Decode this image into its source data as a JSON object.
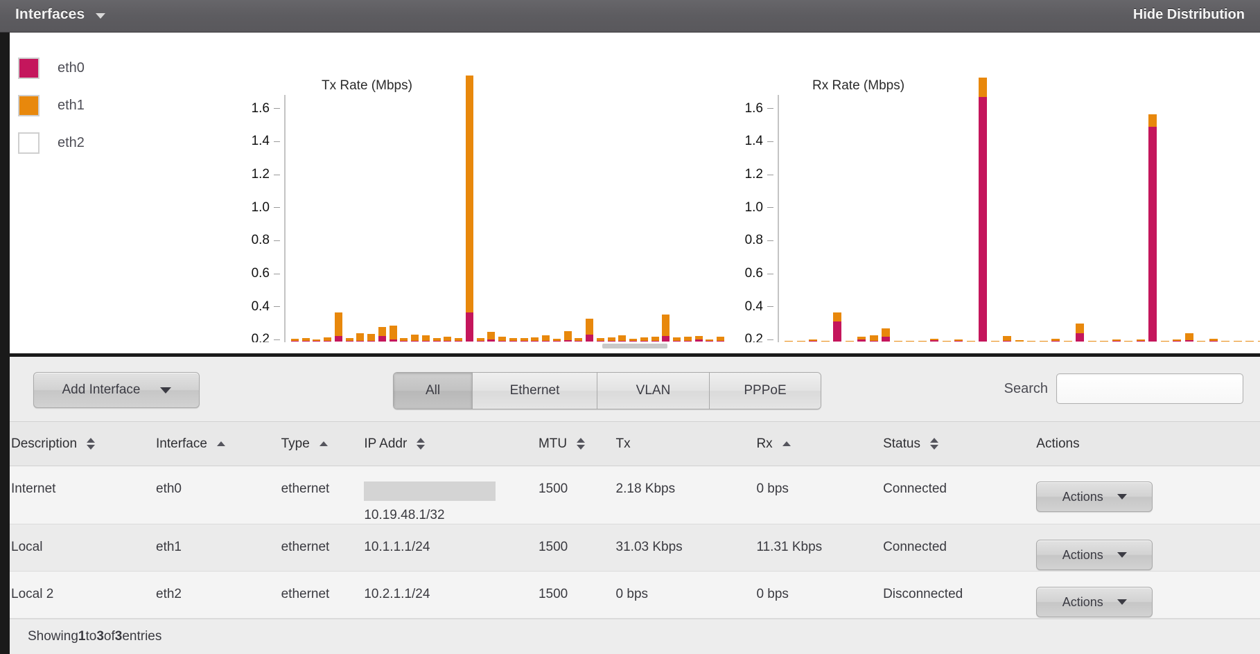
{
  "header": {
    "title": "Interfaces",
    "dropdown_icon": "chevron-down-icon",
    "hide_distribution": "Hide Distribution"
  },
  "legend": {
    "items": [
      {
        "label": "eth0",
        "color": "#c4165c",
        "enabled": true
      },
      {
        "label": "eth1",
        "color": "#e8880c",
        "enabled": true
      },
      {
        "label": "eth2",
        "color": "#ffffff",
        "enabled": false
      }
    ]
  },
  "chart_data": [
    {
      "type": "bar",
      "title": "Tx Rate (Mbps)",
      "xlabel": "",
      "ylabel": "",
      "ylim": [
        0,
        1.7
      ],
      "yticks": [
        "0.2",
        "0.4",
        "0.6",
        "0.8",
        "1.0",
        "1.2",
        "1.4",
        "1.6"
      ],
      "ytick_values": [
        0.2,
        0.4,
        0.6,
        0.8,
        1.0,
        1.2,
        1.4,
        1.6
      ],
      "grid": false,
      "legend_position": "left-outside",
      "stacked": true,
      "series": [
        {
          "name": "eth0",
          "color": "#c4165c",
          "values": [
            0.004,
            0.004,
            0.003,
            0.004,
            0.035,
            0.005,
            0.006,
            0.006,
            0.035,
            0.012,
            0.006,
            0.005,
            0.006,
            0.004,
            0.006,
            0.005,
            0.175,
            0.005,
            0.014,
            0.005,
            0.005,
            0.005,
            0.005,
            0.006,
            0.005,
            0.007,
            0.004,
            0.04,
            0.005,
            0.005,
            0.006,
            0.005,
            0.005,
            0.006,
            0.032,
            0.005,
            0.005,
            0.012,
            0.004,
            0.006
          ]
        },
        {
          "name": "eth1",
          "color": "#e8880c",
          "values": [
            0.014,
            0.015,
            0.01,
            0.022,
            0.14,
            0.014,
            0.046,
            0.042,
            0.053,
            0.085,
            0.017,
            0.036,
            0.03,
            0.016,
            0.024,
            0.018,
            1.435,
            0.014,
            0.043,
            0.026,
            0.018,
            0.018,
            0.02,
            0.03,
            0.012,
            0.054,
            0.017,
            0.1,
            0.016,
            0.02,
            0.03,
            0.013,
            0.022,
            0.025,
            0.13,
            0.022,
            0.024,
            0.022,
            0.01,
            0.022
          ]
        }
      ]
    },
    {
      "type": "bar",
      "title": "Rx Rate (Mbps)",
      "xlabel": "",
      "ylabel": "",
      "ylim": [
        0,
        1.7
      ],
      "yticks": [
        "0.2",
        "0.4",
        "0.6",
        "0.8",
        "1.0",
        "1.2",
        "1.4",
        "1.6"
      ],
      "ytick_values": [
        0.2,
        0.4,
        0.6,
        0.8,
        1.0,
        1.2,
        1.4,
        1.6
      ],
      "grid": false,
      "legend_position": "left-outside",
      "stacked": true,
      "series": [
        {
          "name": "eth0",
          "color": "#c4165c",
          "values": [
            0.0,
            0.0,
            0.006,
            0.0,
            0.12,
            0.0,
            0.012,
            0.006,
            0.03,
            0.0,
            0.0,
            0.0,
            0.008,
            0.0,
            0.006,
            0.0,
            1.48,
            0.0,
            0.004,
            0.0,
            0.0,
            0.0,
            0.006,
            0.0,
            0.05,
            0.0,
            0.0,
            0.004,
            0.0,
            0.006,
            1.3,
            0.0,
            0.004,
            0.01,
            0.0,
            0.005,
            0.0,
            0.0,
            0.0,
            0.0
          ]
        },
        {
          "name": "eth1",
          "color": "#e8880c",
          "values": [
            0.006,
            0.004,
            0.008,
            0.004,
            0.055,
            0.004,
            0.016,
            0.03,
            0.05,
            0.006,
            0.005,
            0.004,
            0.01,
            0.006,
            0.008,
            0.004,
            0.12,
            0.006,
            0.03,
            0.01,
            0.005,
            0.004,
            0.012,
            0.005,
            0.06,
            0.006,
            0.004,
            0.01,
            0.005,
            0.008,
            0.075,
            0.005,
            0.01,
            0.04,
            0.005,
            0.01,
            0.006,
            0.005,
            0.004,
            0.006
          ]
        }
      ]
    }
  ],
  "toolbar": {
    "add_interface_label": "Add Interface",
    "add_interface_caret": "chevron-down-icon",
    "filters": [
      {
        "label": "All",
        "active": true
      },
      {
        "label": "Ethernet",
        "active": false
      },
      {
        "label": "VLAN",
        "active": false
      },
      {
        "label": "PPPoE",
        "active": false
      }
    ],
    "search_label": "Search",
    "search_value": "",
    "search_placeholder": ""
  },
  "table": {
    "columns": [
      {
        "label": "Description",
        "sort": "both"
      },
      {
        "label": "Interface",
        "sort": "asc"
      },
      {
        "label": "Type",
        "sort": "asc"
      },
      {
        "label": "IP Addr",
        "sort": "both"
      },
      {
        "label": "MTU",
        "sort": "both"
      },
      {
        "label": "Tx",
        "sort": "none"
      },
      {
        "label": "Rx",
        "sort": "asc"
      },
      {
        "label": "Status",
        "sort": "both"
      },
      {
        "label": "Actions",
        "sort": "none"
      }
    ],
    "rows": [
      {
        "description": "Internet",
        "interface": "eth0",
        "type": "ethernet",
        "ip_redacted": true,
        "ip_addr": "10.19.48.1/32",
        "mtu": "1500",
        "tx": "2.18 Kbps",
        "rx": "0 bps",
        "status": "Connected",
        "status_state": "connected",
        "action_label": "Actions"
      },
      {
        "description": "Local",
        "interface": "eth1",
        "type": "ethernet",
        "ip_redacted": false,
        "ip_addr": "10.1.1.1/24",
        "mtu": "1500",
        "tx": "31.03 Kbps",
        "rx": "11.31 Kbps",
        "status": "Connected",
        "status_state": "connected",
        "action_label": "Actions"
      },
      {
        "description": "Local 2",
        "interface": "eth2",
        "type": "ethernet",
        "ip_redacted": false,
        "ip_addr": "10.2.1.1/24",
        "mtu": "1500",
        "tx": "0 bps",
        "rx": "0 bps",
        "status": "Disconnected",
        "status_state": "disconnected",
        "action_label": "Actions"
      }
    ]
  },
  "footer": {
    "prefix": "Showing ",
    "from": "1",
    "mid": " to ",
    "to": "3",
    "mid2": " of ",
    "total": "3",
    "suffix": " entries"
  },
  "colors": {
    "eth0": "#c4165c",
    "eth1": "#e8880c",
    "connected": "#3f8a22",
    "disconnected": "#ef7f23"
  }
}
